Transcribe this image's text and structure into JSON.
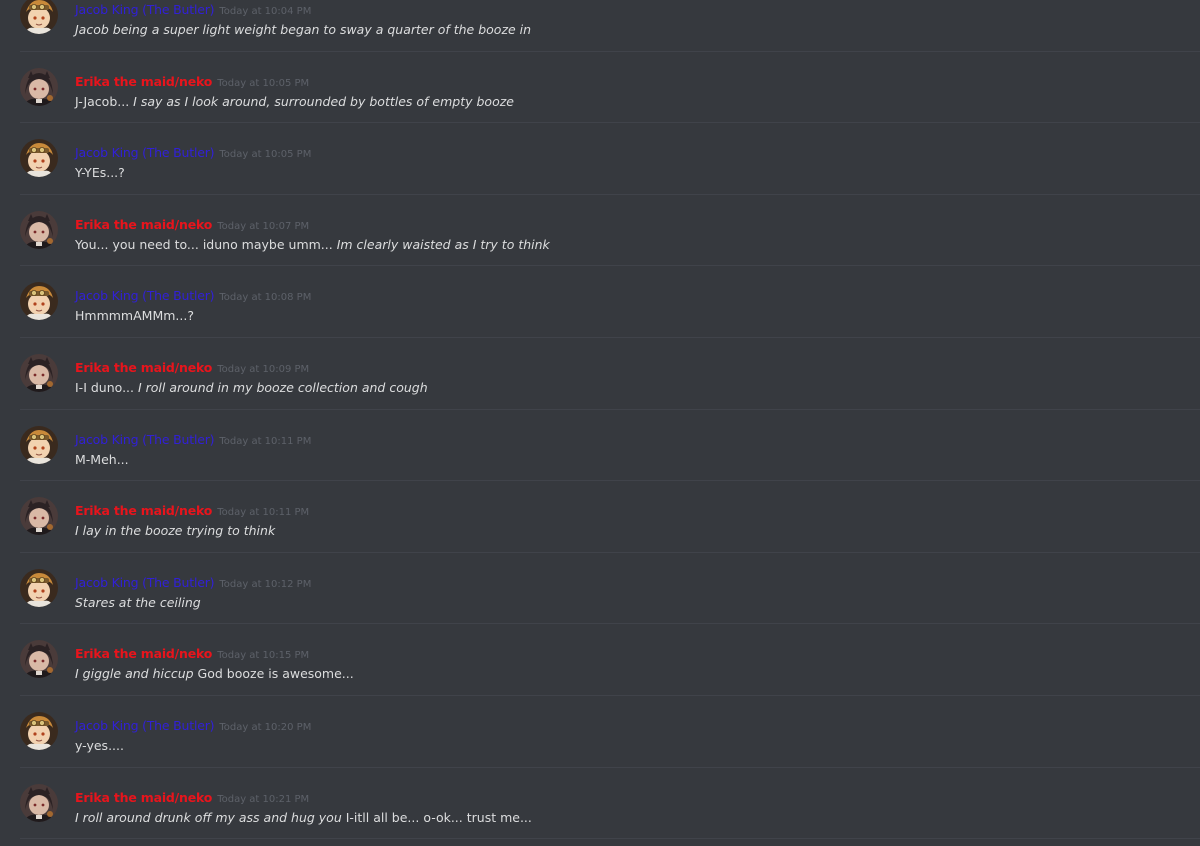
{
  "colors": {
    "background": "#36393e",
    "divider": "#40434a",
    "jacob_name": "#3120d6",
    "erika_name": "#e8141c",
    "text": "#dcddde",
    "timestamp": "#5d6169"
  },
  "messages": [
    {
      "author": "Jacob King (The Butler)",
      "role": "jacob",
      "time": "Today at 10:04 PM",
      "parts": [
        {
          "text": "Jacob being a super light weight began to sway a quarter of the booze in",
          "italic": true
        }
      ]
    },
    {
      "author": "Erika the maid/neko",
      "role": "erika",
      "time": "Today at 10:05 PM",
      "parts": [
        {
          "text": "J-Jacob... ",
          "italic": false
        },
        {
          "text": "I say as I look around, surrounded by bottles of empty booze",
          "italic": true
        }
      ]
    },
    {
      "author": "Jacob King (The Butler)",
      "role": "jacob",
      "time": "Today at 10:05 PM",
      "parts": [
        {
          "text": "Y-YEs...?",
          "italic": false
        }
      ]
    },
    {
      "author": "Erika the maid/neko",
      "role": "erika",
      "time": "Today at 10:07 PM",
      "parts": [
        {
          "text": "You... you need to... iduno maybe umm... ",
          "italic": false
        },
        {
          "text": "Im clearly waisted as I try to think",
          "italic": true
        }
      ]
    },
    {
      "author": "Jacob King (The Butler)",
      "role": "jacob",
      "time": "Today at 10:08 PM",
      "parts": [
        {
          "text": "HmmmmAMMm...?",
          "italic": false
        }
      ]
    },
    {
      "author": "Erika the maid/neko",
      "role": "erika",
      "time": "Today at 10:09 PM",
      "parts": [
        {
          "text": "I-I duno... ",
          "italic": false
        },
        {
          "text": "I roll around in my booze collection and cough",
          "italic": true
        }
      ]
    },
    {
      "author": "Jacob King (The Butler)",
      "role": "jacob",
      "time": "Today at 10:11 PM",
      "parts": [
        {
          "text": "M-Meh...",
          "italic": false
        }
      ]
    },
    {
      "author": "Erika the maid/neko",
      "role": "erika",
      "time": "Today at 10:11 PM",
      "parts": [
        {
          "text": "I lay in the booze trying to think",
          "italic": true
        }
      ]
    },
    {
      "author": "Jacob King (The Butler)",
      "role": "jacob",
      "time": "Today at 10:12 PM",
      "parts": [
        {
          "text": "Stares at the ceiling",
          "italic": true
        }
      ]
    },
    {
      "author": "Erika the maid/neko",
      "role": "erika",
      "time": "Today at 10:15 PM",
      "parts": [
        {
          "text": "I giggle and hiccup",
          "italic": true
        },
        {
          "text": " God booze is awesome...",
          "italic": false
        }
      ]
    },
    {
      "author": "Jacob King (The Butler)",
      "role": "jacob",
      "time": "Today at 10:20 PM",
      "parts": [
        {
          "text": "y-yes....",
          "italic": false
        }
      ]
    },
    {
      "author": "Erika the maid/neko",
      "role": "erika",
      "time": "Today at 10:21 PM",
      "parts": [
        {
          "text": "I roll around drunk off my ass and hug you",
          "italic": true
        },
        {
          "text": " I-itll all be... o-ok... trust me...",
          "italic": false
        }
      ]
    }
  ]
}
